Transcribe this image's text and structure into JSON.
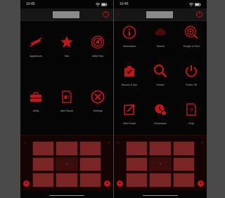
{
  "colors": {
    "accent": "#c0171b",
    "background": "#050505",
    "keypad": "#7a2626"
  },
  "left_screen": {
    "status": {
      "time": "10:45"
    },
    "grid": [
      {
        "label": "Appliances",
        "icon": "no-signal-icon"
      },
      {
        "label": "Star",
        "icon": "star-icon"
      },
      {
        "label": "Make Sky",
        "icon": "radar-icon"
      },
      {
        "label": "Utility",
        "icon": "toolbox-icon"
      },
      {
        "label": "Add Report",
        "icon": "report-icon"
      },
      {
        "label": "Settings",
        "icon": "close-circle-icon"
      }
    ],
    "keypad": {
      "center": "+",
      "arrows": [
        "<",
        ">"
      ]
    }
  },
  "right_screen": {
    "status": {
      "time": "10:45"
    },
    "grid": [
      {
        "label": "Information",
        "icon": "info-icon"
      },
      {
        "label": "Tutorial",
        "icon": "cloud-icon"
      },
      {
        "label": "Google & Find",
        "icon": "search-target-icon"
      },
      {
        "label": "Record & Use",
        "icon": "camera-icon"
      },
      {
        "label": "Search",
        "icon": "magnifier-icon"
      },
      {
        "label": "Power Off",
        "icon": "power-icon"
      },
      {
        "label": "Web Portal",
        "icon": "external-link-icon"
      },
      {
        "label": "Reminders",
        "icon": "alarm-icon"
      },
      {
        "label": "Help",
        "icon": "help-doc-icon"
      }
    ],
    "keypad": {
      "center": "+",
      "arrows": [
        "<",
        ">"
      ]
    }
  }
}
